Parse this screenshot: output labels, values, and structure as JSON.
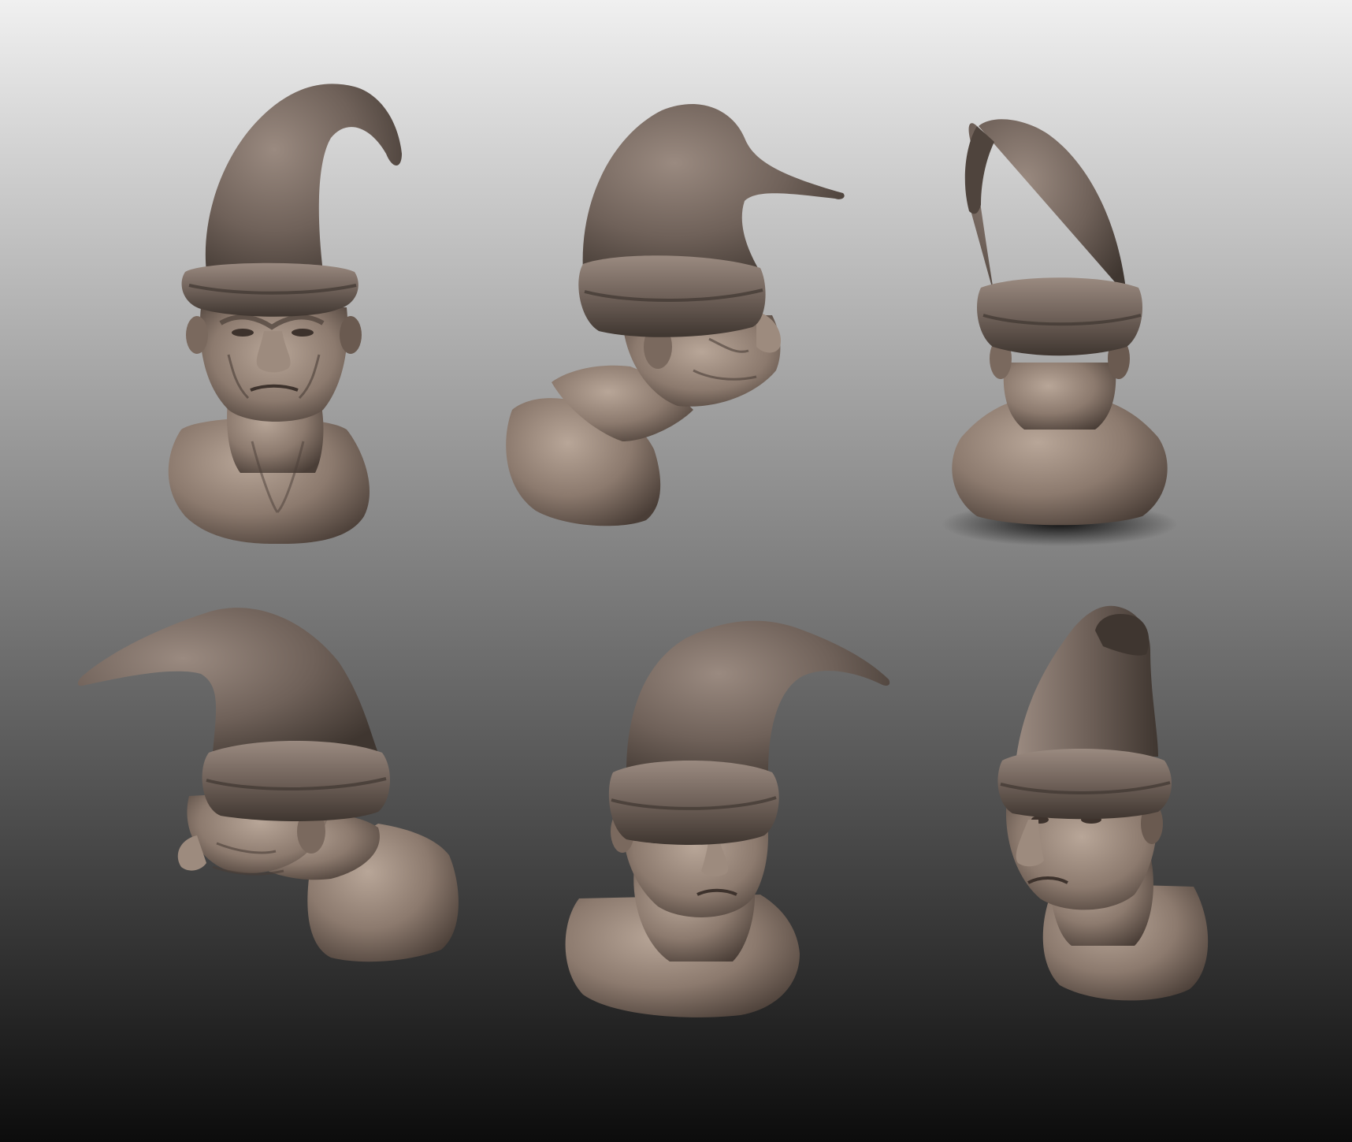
{
  "scene": {
    "background": {
      "top_color": "#f0f0f0",
      "mid_color": "#8a8a8a",
      "bottom_color": "#0c0c0c"
    },
    "material_colors": {
      "hat_base": "#6f6159",
      "hat_light": "#9a8a80",
      "hat_dark": "#3f3630",
      "skin_base": "#8c7a6e",
      "skin_light": "#b8a698",
      "skin_dark": "#4a3e37",
      "shadow": "#000000"
    },
    "views": [
      {
        "id": "front",
        "row": 1,
        "column": 1
      },
      {
        "id": "right-profile",
        "row": 1,
        "column": 2
      },
      {
        "id": "back",
        "row": 1,
        "column": 3
      },
      {
        "id": "left-profile",
        "row": 2,
        "column": 1
      },
      {
        "id": "three-quarter-right",
        "row": 2,
        "column": 2
      },
      {
        "id": "three-quarter-left",
        "row": 2,
        "column": 3
      }
    ]
  }
}
